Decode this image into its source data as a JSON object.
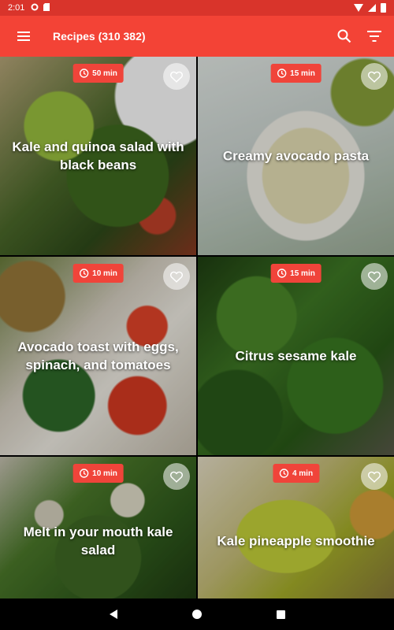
{
  "status_bar": {
    "time": "2:01"
  },
  "app_bar": {
    "title": "Recipes (310 382)"
  },
  "recipes": [
    {
      "title": "Kale and quinoa salad with black beans",
      "time": "50 min"
    },
    {
      "title": "Creamy avocado pasta",
      "time": "15 min"
    },
    {
      "title": "Avocado toast with eggs, spinach, and tomatoes",
      "time": "10 min"
    },
    {
      "title": "Citrus sesame kale",
      "time": "15 min"
    },
    {
      "title": "Melt in your mouth kale salad",
      "time": "10 min"
    },
    {
      "title": "Kale pineapple smoothie",
      "time": "4 min"
    }
  ],
  "colors": {
    "primary": "#f34336",
    "status": "#d9342b",
    "badge": "#f0443a"
  }
}
